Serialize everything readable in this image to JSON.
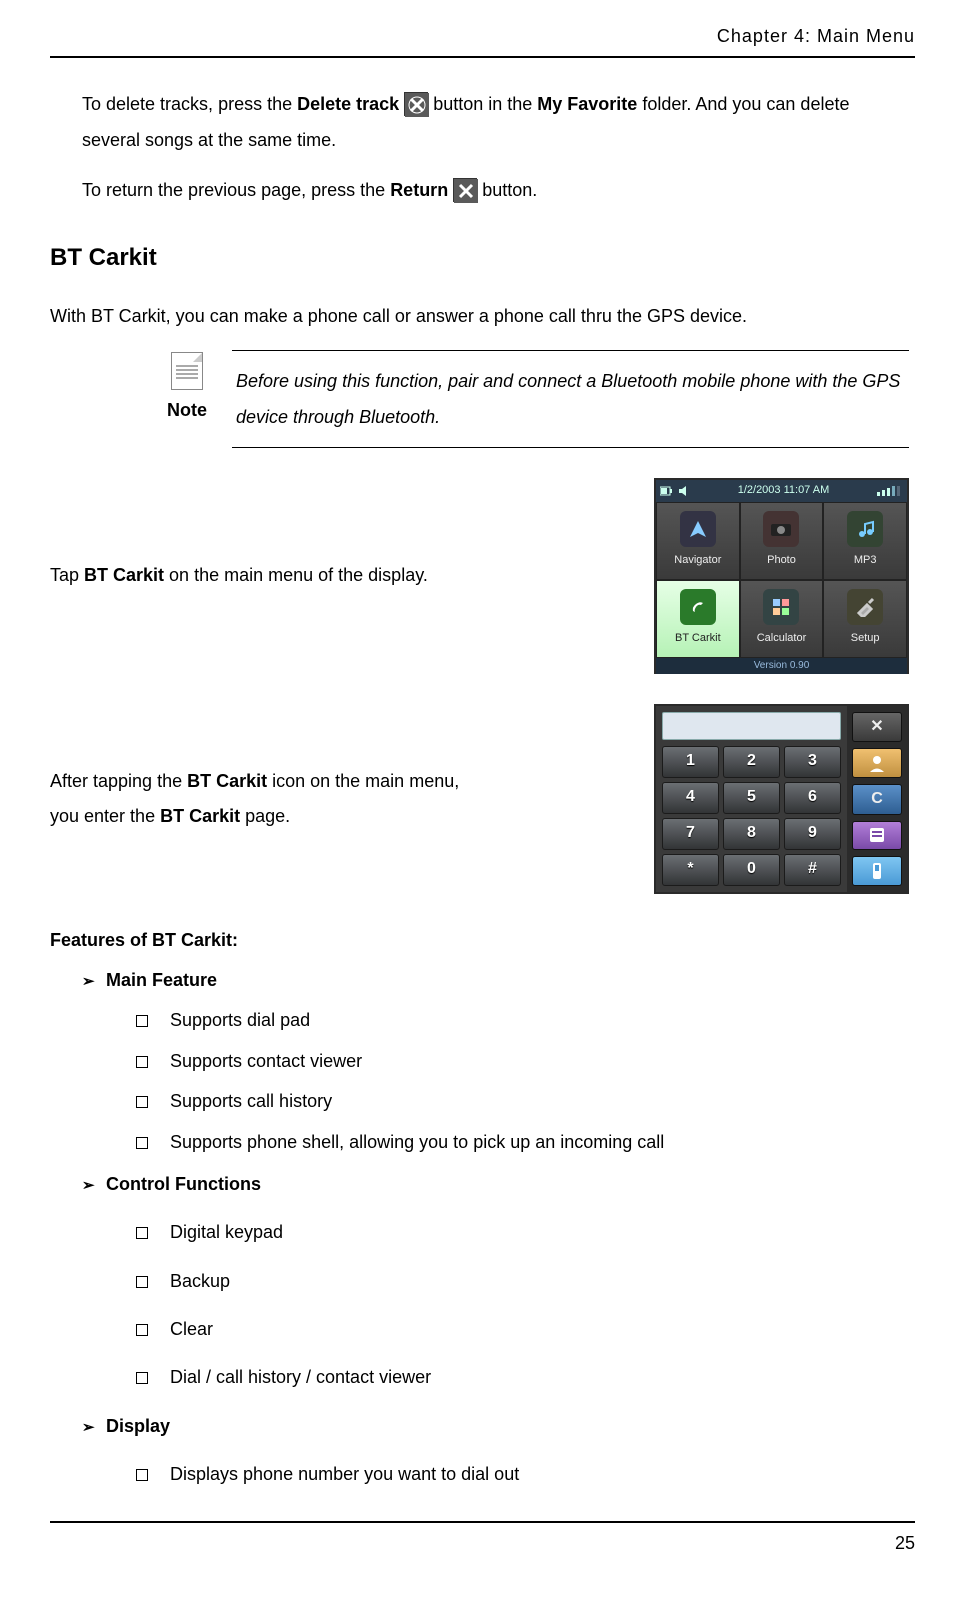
{
  "header": {
    "chapter": "Chapter 4: Main Menu"
  },
  "p1": {
    "pre": "To delete tracks, press the ",
    "bold1": "Delete track",
    "mid": " button in the ",
    "bold2": "My Favorite",
    "post": " folder. And you can delete several songs at the same time."
  },
  "p2": {
    "pre": "To return the previous page, press the ",
    "bold1": "Return",
    "post": " button."
  },
  "h2": "BT Carkit",
  "p3": "With BT Carkit, you can make a phone call or answer a phone call thru the GPS device.",
  "note": {
    "label": "Note",
    "text": "Before using this function, pair and connect a Bluetooth mobile phone with the GPS device through Bluetooth."
  },
  "row1": {
    "pre": "Tap ",
    "bold": "BT Carkit",
    "post": " on the main menu of the display."
  },
  "row2": {
    "l1_pre": "After tapping the ",
    "l1_bold": "BT Carkit",
    "l1_post": " icon on the main menu,",
    "l2_pre": "you enter the ",
    "l2_bold": "BT Carkit",
    "l2_post": " page."
  },
  "screenshot_menu": {
    "time": "1/2/2003 11:07 AM",
    "cells": [
      "Navigator",
      "Photo",
      "MP3",
      "BT Carkit",
      "Calculator",
      "Setup"
    ],
    "version": "Version 0.90"
  },
  "screenshot_dialer": {
    "keys": [
      "1",
      "2",
      "3",
      "4",
      "5",
      "6",
      "7",
      "8",
      "9",
      "*",
      "0",
      "#"
    ],
    "clear": "C",
    "close": "✕"
  },
  "features_heading": "Features of BT Carkit:",
  "sections": [
    {
      "title": "Main Feature",
      "items": [
        "Supports dial pad",
        "Supports contact viewer",
        "Supports call history",
        "Supports phone shell, allowing you to pick up an incoming call"
      ],
      "spaced": false
    },
    {
      "title": "Control Functions",
      "items": [
        "Digital keypad",
        "Backup",
        "Clear",
        "Dial / call history / contact viewer"
      ],
      "spaced": true
    },
    {
      "title": "Display",
      "items": [
        "Displays phone number you want to dial out"
      ],
      "spaced": true
    }
  ],
  "page_number": "25"
}
